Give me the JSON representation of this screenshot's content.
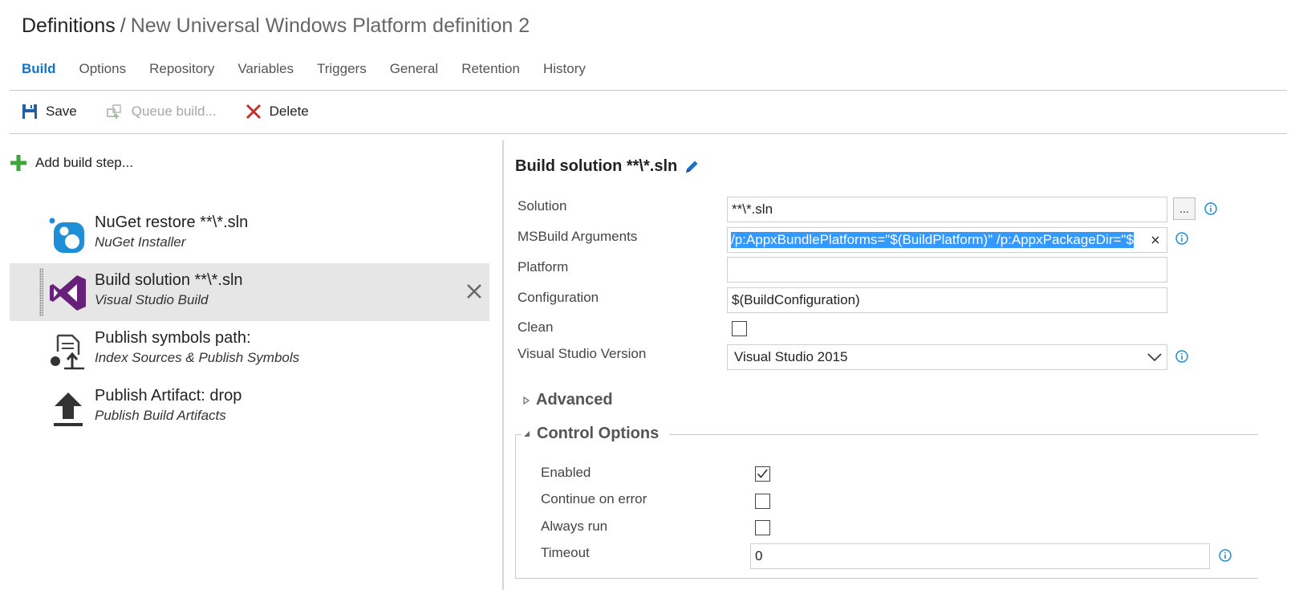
{
  "breadcrumb": {
    "root": "Definitions",
    "separator": "/",
    "current": "New Universal Windows Platform definition 2"
  },
  "tabs": [
    {
      "label": "Build",
      "active": true
    },
    {
      "label": "Options"
    },
    {
      "label": "Repository"
    },
    {
      "label": "Variables"
    },
    {
      "label": "Triggers"
    },
    {
      "label": "General"
    },
    {
      "label": "Retention"
    },
    {
      "label": "History"
    }
  ],
  "toolbar": {
    "save_label": "Save",
    "queue_label": "Queue build...",
    "delete_label": "Delete"
  },
  "add_step_label": "Add build step...",
  "steps": [
    {
      "name": "NuGet restore **\\*.sln",
      "type": "NuGet Installer",
      "icon": "nuget-icon"
    },
    {
      "name": "Build solution **\\*.sln",
      "type": "Visual Studio Build",
      "icon": "visual-studio-icon",
      "selected": true
    },
    {
      "name": "Publish symbols path:",
      "type": "Index Sources & Publish Symbols",
      "icon": "publish-symbols-icon"
    },
    {
      "name": "Publish Artifact: drop",
      "type": "Publish Build Artifacts",
      "icon": "upload-icon"
    }
  ],
  "detail": {
    "title": "Build solution **\\*.sln",
    "fields": {
      "solution": {
        "label": "Solution",
        "value": "**\\*.sln",
        "browse": "..."
      },
      "msbuild": {
        "label": "MSBuild Arguments",
        "value": "/p:AppxBundlePlatforms=\"$(BuildPlatform)\" /p:AppxPackageDir=\"$"
      },
      "platform": {
        "label": "Platform",
        "value": ""
      },
      "configuration": {
        "label": "Configuration",
        "value": "$(BuildConfiguration)"
      },
      "clean": {
        "label": "Clean",
        "checked": false
      },
      "vs_version": {
        "label": "Visual Studio Version",
        "value": "Visual Studio 2015"
      }
    },
    "advanced_label": "Advanced",
    "control_options": {
      "label": "Control Options",
      "enabled": {
        "label": "Enabled",
        "checked": true
      },
      "continue_on_error": {
        "label": "Continue on error",
        "checked": false
      },
      "always_run": {
        "label": "Always run",
        "checked": false
      },
      "timeout": {
        "label": "Timeout",
        "value": "0"
      }
    }
  },
  "colors": {
    "accent": "#1474c4",
    "selection": "#3399ff",
    "selected_row": "#e6e6e6",
    "delete_red": "#c4302b",
    "add_green": "#3ba539",
    "vs_purple": "#68217a"
  }
}
